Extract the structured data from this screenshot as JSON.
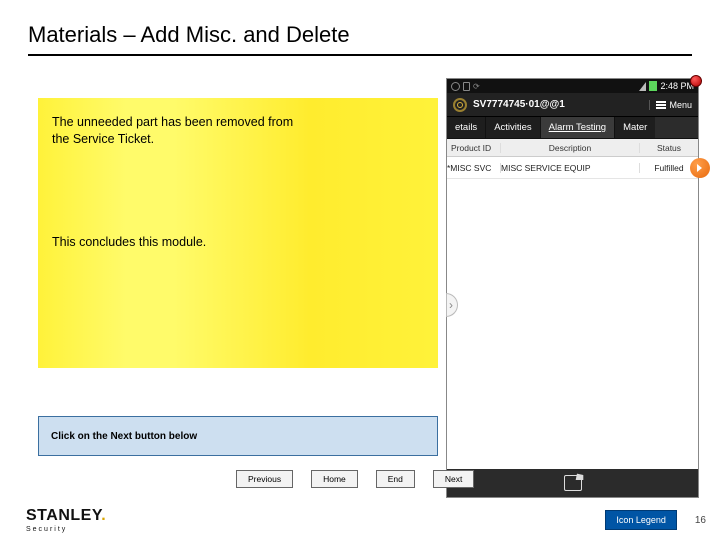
{
  "title": "Materials – Add Misc. and Delete",
  "callout": {
    "p1": "The unneeded part has been removed from the Service Ticket.",
    "p2": "This concludes this module."
  },
  "prompt": "Click on the Next button below",
  "nav": {
    "previous": "Previous",
    "home": "Home",
    "end": "End",
    "next": "Next"
  },
  "footer": {
    "brand": "STANLEY",
    "brand_sub": "Security",
    "icon_legend": "Icon Legend",
    "page": "16"
  },
  "phone": {
    "clock": "2:48 PM",
    "ticket": "SV7774745·01@@1",
    "menu": "Menu",
    "tabs": {
      "t1": "etails",
      "t2": "Activities",
      "t3": "Alarm Testing",
      "t4": "Mater"
    },
    "columns": {
      "id": "Product ID",
      "desc": "Description",
      "status": "Status"
    },
    "row": {
      "id": "*MISC SVC",
      "desc": "MISC SERVICE EQUIP",
      "status": "Fulfilled"
    }
  },
  "chart_data": {
    "type": "table",
    "title": "Materials list",
    "columns": [
      "Product ID",
      "Description",
      "Status"
    ],
    "rows": [
      [
        "*MISC SVC",
        "MISC SERVICE EQUIP",
        "Fulfilled"
      ]
    ]
  }
}
